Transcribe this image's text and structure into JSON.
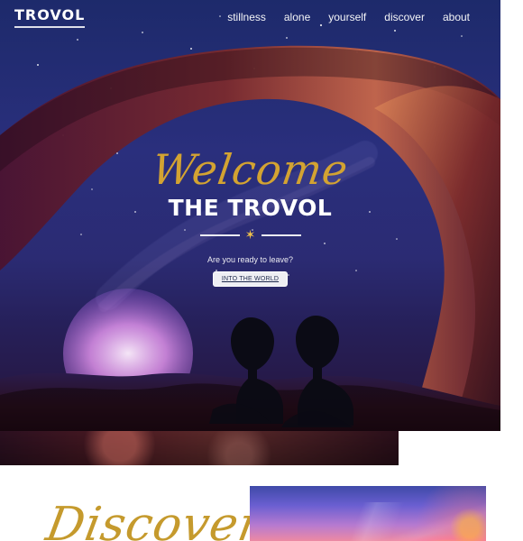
{
  "header": {
    "logo": "TROVOL",
    "nav": [
      "stillness",
      "alone",
      "yourself",
      "discover",
      "about"
    ]
  },
  "hero": {
    "welcome": "Welcome",
    "title": "THE TROVOL",
    "tagline": "Are you ready to leave?",
    "cta_label": "INTO THE WORLD"
  },
  "discover": {
    "title": "Discover"
  },
  "colors": {
    "gold": "#c59a2d",
    "hero_gold": "#d3a332",
    "white": "#ffffff"
  }
}
